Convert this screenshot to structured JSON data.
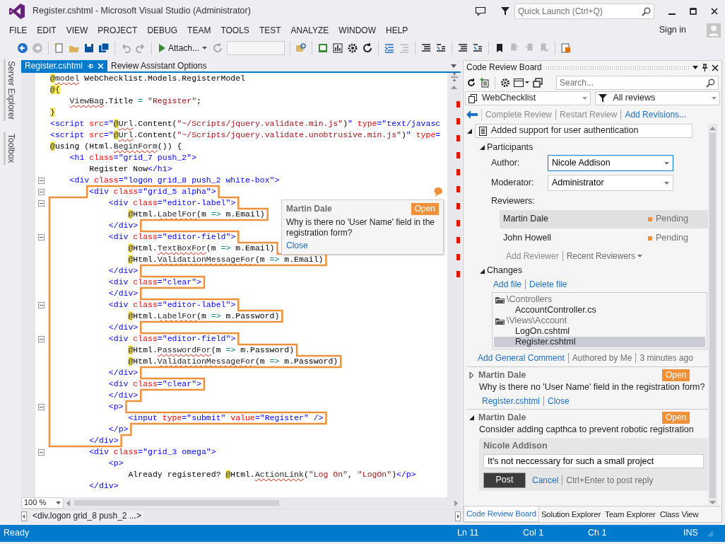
{
  "title_bar": {
    "title": "Register.cshtml - Microsoft Visual Studio (Administrator)",
    "quick_launch": {
      "placeholder": "Quick Launch (Ctrl+Q)"
    }
  },
  "menu": [
    "FILE",
    "EDIT",
    "VIEW",
    "PROJECT",
    "DEBUG",
    "TEAM",
    "TOOLS",
    "TEST",
    "ANALYZE",
    "WINDOW",
    "HELP"
  ],
  "sign_in": "Sign in",
  "toolbar": {
    "attach_button": "Attach..."
  },
  "side_tabs": [
    "Server Explorer",
    "Toolbox"
  ],
  "editor": {
    "tabs": [
      {
        "label": "Register.cshtml",
        "selected": true
      },
      {
        "label": "Review Assistant Options",
        "selected": false
      }
    ],
    "lines": [
      {
        "collapsible": false,
        "commented": false,
        "tokens": [
          {
            "kind": "at",
            "text": "@"
          },
          {
            "kind": "err",
            "text": "model"
          },
          {
            "kind": "plain",
            "text": " WebChecklist.Models.RegisterModel"
          }
        ]
      },
      {
        "collapsible": false,
        "commented": false,
        "tokens": [
          {
            "kind": "at",
            "text": "@{"
          }
        ]
      },
      {
        "collapsible": false,
        "commented": false,
        "tokens": [
          {
            "kind": "err",
            "text": "    ViewBag"
          },
          {
            "kind": "plain",
            "text": ".Title "
          },
          {
            "kind": "op",
            "text": "="
          },
          {
            "kind": "str",
            "text": " \"Register\""
          },
          {
            "kind": "plain",
            "text": ";"
          }
        ]
      },
      {
        "collapsible": false,
        "commented": false,
        "tokens": [
          {
            "kind": "at",
            "text": "}"
          }
        ]
      },
      {
        "collapsible": false,
        "commented": false,
        "tokens": [
          {
            "kind": "tag",
            "text": "<script "
          },
          {
            "kind": "attr",
            "text": "src"
          },
          {
            "kind": "tag",
            "text": "=\""
          },
          {
            "kind": "at",
            "text": "@"
          },
          {
            "kind": "err",
            "text": "Url"
          },
          {
            "kind": "plain",
            "text": ".Content("
          },
          {
            "kind": "str",
            "text": "\"~/Scripts/jquery.validate.min.js\""
          },
          {
            "kind": "plain",
            "text": ")"
          },
          {
            "kind": "tag",
            "text": "\" "
          },
          {
            "kind": "attr",
            "text": "type"
          },
          {
            "kind": "tag",
            "text": "=\"text/javasc"
          }
        ]
      },
      {
        "collapsible": false,
        "commented": false,
        "tokens": [
          {
            "kind": "tag",
            "text": "<script "
          },
          {
            "kind": "attr",
            "text": "src"
          },
          {
            "kind": "tag",
            "text": "=\""
          },
          {
            "kind": "at",
            "text": "@"
          },
          {
            "kind": "err",
            "text": "Url"
          },
          {
            "kind": "plain",
            "text": ".Content("
          },
          {
            "kind": "str",
            "text": "\"~/Scripts/jquery.validate.unobtrusive.min.js\""
          },
          {
            "kind": "plain",
            "text": ")"
          },
          {
            "kind": "tag",
            "text": "\" "
          },
          {
            "kind": "attr",
            "text": "type"
          },
          {
            "kind": "tag",
            "text": "="
          }
        ]
      },
      {
        "collapsible": false,
        "commented": false,
        "tokens": [
          {
            "kind": "at",
            "text": "@"
          },
          {
            "kind": "plain",
            "text": "using (Html."
          },
          {
            "kind": "err",
            "text": "BeginForm"
          },
          {
            "kind": "plain",
            "text": "()) {"
          }
        ]
      },
      {
        "collapsible": false,
        "commented": false,
        "tokens": [
          {
            "kind": "tag",
            "text": "    <h1 "
          },
          {
            "kind": "attr",
            "text": "class"
          },
          {
            "kind": "tag",
            "text": "=\"grid_7 push_2\">"
          }
        ]
      },
      {
        "collapsible": false,
        "commented": false,
        "tokens": [
          {
            "kind": "plain",
            "text": "        Register Now"
          },
          {
            "kind": "tag",
            "text": "</h1>"
          }
        ]
      },
      {
        "collapsible": true,
        "commented": false,
        "tokens": [
          {
            "kind": "tag",
            "text": "    <div "
          },
          {
            "kind": "attr",
            "text": "class"
          },
          {
            "kind": "tag",
            "text": "=\"logon grid_8 push_2 white-box\">"
          }
        ]
      },
      {
        "collapsible": true,
        "commented": true,
        "tokens": [
          {
            "kind": "tag",
            "text": "        <div "
          },
          {
            "kind": "attr",
            "text": "class"
          },
          {
            "kind": "tag",
            "text": "=\"grid_5 alpha\">"
          }
        ]
      },
      {
        "collapsible": true,
        "commented": true,
        "tokens": [
          {
            "kind": "tag",
            "text": "            <div "
          },
          {
            "kind": "attr",
            "text": "class"
          },
          {
            "kind": "tag",
            "text": "=\"editor-label\">"
          }
        ]
      },
      {
        "collapsible": false,
        "commented": true,
        "tokens": [
          {
            "kind": "at",
            "text": "                @"
          },
          {
            "kind": "plain",
            "text": "Html."
          },
          {
            "kind": "err",
            "text": "LabelFor"
          },
          {
            "kind": "plain",
            "text": "(m "
          },
          {
            "kind": "op",
            "text": "=>"
          },
          {
            "kind": "plain",
            "text": " m.Email)"
          }
        ]
      },
      {
        "collapsible": false,
        "commented": true,
        "tokens": [
          {
            "kind": "tag",
            "text": "            </div>"
          }
        ]
      },
      {
        "collapsible": true,
        "commented": true,
        "tokens": [
          {
            "kind": "tag",
            "text": "            <div "
          },
          {
            "kind": "attr",
            "text": "class"
          },
          {
            "kind": "tag",
            "text": "=\"editor-field\">"
          }
        ]
      },
      {
        "collapsible": false,
        "commented": true,
        "tokens": [
          {
            "kind": "at",
            "text": "                @"
          },
          {
            "kind": "plain",
            "text": "Html."
          },
          {
            "kind": "err",
            "text": "TextBoxFor"
          },
          {
            "kind": "plain",
            "text": "(m "
          },
          {
            "kind": "op",
            "text": "=>"
          },
          {
            "kind": "plain",
            "text": " m.Email)"
          }
        ]
      },
      {
        "collapsible": false,
        "commented": true,
        "tokens": [
          {
            "kind": "at",
            "text": "                @"
          },
          {
            "kind": "plain",
            "text": "Html."
          },
          {
            "kind": "err",
            "text": "ValidationMessageFor"
          },
          {
            "kind": "plain",
            "text": "(m "
          },
          {
            "kind": "op",
            "text": "=>"
          },
          {
            "kind": "plain",
            "text": " m.Email)"
          }
        ]
      },
      {
        "collapsible": false,
        "commented": true,
        "tokens": [
          {
            "kind": "tag",
            "text": "            </div>"
          }
        ]
      },
      {
        "collapsible": false,
        "commented": true,
        "tokens": [
          {
            "kind": "tag",
            "text": "            <div "
          },
          {
            "kind": "attr",
            "text": "class"
          },
          {
            "kind": "tag",
            "text": "=\"clear\">"
          }
        ]
      },
      {
        "collapsible": false,
        "commented": true,
        "tokens": [
          {
            "kind": "tag",
            "text": "            </div>"
          }
        ]
      },
      {
        "collapsible": true,
        "commented": true,
        "tokens": [
          {
            "kind": "tag",
            "text": "            <div "
          },
          {
            "kind": "attr",
            "text": "class"
          },
          {
            "kind": "tag",
            "text": "=\"editor-label\">"
          }
        ]
      },
      {
        "collapsible": false,
        "commented": true,
        "tokens": [
          {
            "kind": "at",
            "text": "                @"
          },
          {
            "kind": "plain",
            "text": "Html."
          },
          {
            "kind": "err",
            "text": "LabelFor"
          },
          {
            "kind": "plain",
            "text": "(m "
          },
          {
            "kind": "op",
            "text": "=>"
          },
          {
            "kind": "plain",
            "text": " m.Password)"
          }
        ]
      },
      {
        "collapsible": false,
        "commented": true,
        "tokens": [
          {
            "kind": "tag",
            "text": "            </div>"
          }
        ]
      },
      {
        "collapsible": true,
        "commented": true,
        "tokens": [
          {
            "kind": "tag",
            "text": "            <div "
          },
          {
            "kind": "attr",
            "text": "class"
          },
          {
            "kind": "tag",
            "text": "=\"editor-field\">"
          }
        ]
      },
      {
        "collapsible": false,
        "commented": true,
        "tokens": [
          {
            "kind": "at",
            "text": "                @"
          },
          {
            "kind": "plain",
            "text": "Html."
          },
          {
            "kind": "err",
            "text": "PasswordFor"
          },
          {
            "kind": "plain",
            "text": "(m "
          },
          {
            "kind": "op",
            "text": "=>"
          },
          {
            "kind": "plain",
            "text": " m.Password)"
          }
        ]
      },
      {
        "collapsible": false,
        "commented": true,
        "tokens": [
          {
            "kind": "at",
            "text": "                @"
          },
          {
            "kind": "plain",
            "text": "Html."
          },
          {
            "kind": "err",
            "text": "ValidationMessageFor"
          },
          {
            "kind": "plain",
            "text": "(m "
          },
          {
            "kind": "op",
            "text": "=>"
          },
          {
            "kind": "plain",
            "text": " m.Password)"
          }
        ]
      },
      {
        "collapsible": false,
        "commented": true,
        "tokens": [
          {
            "kind": "tag",
            "text": "            </div>"
          }
        ]
      },
      {
        "collapsible": false,
        "commented": true,
        "tokens": [
          {
            "kind": "tag",
            "text": "            <div "
          },
          {
            "kind": "attr",
            "text": "class"
          },
          {
            "kind": "tag",
            "text": "=\"clear\">"
          }
        ]
      },
      {
        "collapsible": false,
        "commented": true,
        "tokens": [
          {
            "kind": "tag",
            "text": "            </div>"
          }
        ]
      },
      {
        "collapsible": true,
        "commented": true,
        "tokens": [
          {
            "kind": "tag",
            "text": "            <p>"
          }
        ]
      },
      {
        "collapsible": false,
        "commented": true,
        "tokens": [
          {
            "kind": "tag",
            "text": "                <input "
          },
          {
            "kind": "attr",
            "text": "type"
          },
          {
            "kind": "tag",
            "text": "=\"submit\" "
          },
          {
            "kind": "attr",
            "text": "value"
          },
          {
            "kind": "tag",
            "text": "=\"Register\" />"
          }
        ]
      },
      {
        "collapsible": false,
        "commented": true,
        "tokens": [
          {
            "kind": "tag",
            "text": "            </p>"
          }
        ]
      },
      {
        "collapsible": false,
        "commented": true,
        "tokens": [
          {
            "kind": "tag",
            "text": "        </div>"
          }
        ]
      },
      {
        "collapsible": true,
        "commented": false,
        "tokens": [
          {
            "kind": "tag",
            "text": "        <div "
          },
          {
            "kind": "attr",
            "text": "class"
          },
          {
            "kind": "tag",
            "text": "=\"grid_3 omega\">"
          }
        ]
      },
      {
        "collapsible": false,
        "commented": false,
        "tokens": [
          {
            "kind": "tag",
            "text": "            <p>"
          }
        ]
      },
      {
        "collapsible": false,
        "commented": false,
        "tokens": [
          {
            "kind": "plain",
            "text": "                Already registered? "
          },
          {
            "kind": "at",
            "text": "@"
          },
          {
            "kind": "plain",
            "text": "Html."
          },
          {
            "kind": "err",
            "text": "ActionLink"
          },
          {
            "kind": "plain",
            "text": "("
          },
          {
            "kind": "str",
            "text": "\"Log On\""
          },
          {
            "kind": "plain",
            "text": ", "
          },
          {
            "kind": "str",
            "text": "\"LogOn\""
          },
          {
            "kind": "plain",
            "text": ")"
          },
          {
            "kind": "tag",
            "text": "</p>"
          }
        ]
      },
      {
        "collapsible": false,
        "commented": false,
        "tokens": [
          {
            "kind": "tag",
            "text": "        </div>"
          }
        ]
      }
    ],
    "comment_popup": {
      "author": "Martin Dale",
      "status": "Open",
      "text": "Why is there no 'User Name' field  in the registration form?",
      "close": "Close"
    },
    "zoom": "100 %",
    "breadcrumb": "<div.logon grid_8 push_2 ...>"
  },
  "review_board": {
    "title": "Code Review Board",
    "search": {
      "placeholder": "Search..."
    },
    "project": "WebChecklist",
    "filter": "All reviews",
    "actions": [
      {
        "label": "Complete Review",
        "disabled": true
      },
      {
        "label": "Restart Review",
        "disabled": true
      },
      {
        "label": "Add Revisions...",
        "disabled": false
      }
    ],
    "review": {
      "title": "Added support for user authentication",
      "expanded": true,
      "participants": {
        "label": "Participants",
        "expanded": true,
        "author": {
          "label": "Author:",
          "value": "Nicole Addison",
          "focused": true
        },
        "moderator": {
          "label": "Moderator:",
          "value": "Administrator",
          "focused": false
        },
        "reviewers_label": "Reviewers:",
        "reviewers": [
          {
            "name": "Martin Dale",
            "status": "Pending",
            "color": "#f0913a",
            "selected": true
          },
          {
            "name": "John Howell",
            "status": "Pending",
            "color": "#f0913a",
            "selected": false
          }
        ],
        "reviewer_actions": [
          {
            "label": "Add Reviewer",
            "disabled": true,
            "dropdown": false
          },
          {
            "label": "Recent Reviewers",
            "disabled": false,
            "dropdown": true
          }
        ]
      },
      "changes": {
        "label": "Changes",
        "expanded": true,
        "actions": [
          "Add file",
          "Delete file"
        ],
        "files": [
          {
            "name": "\\Controllers",
            "selected": false,
            "children": [
              {
                "name": "AccountController.cs",
                "selected": false
              }
            ]
          },
          {
            "name": "\\Views\\Account",
            "selected": false,
            "children": [
              {
                "name": "LogOn.cshtml",
                "selected": false
              },
              {
                "name": "Register.cshtml",
                "selected": true
              }
            ]
          }
        ]
      },
      "meta": [
        {
          "kind": "link",
          "text": "Add General Comment"
        },
        {
          "kind": "text",
          "text": "Authored by Me"
        },
        {
          "kind": "text",
          "text": "3 minutes ago"
        }
      ]
    },
    "comments": [
      {
        "author": "Martin Dale",
        "status": "Open",
        "expanded": false,
        "text": "Why is there no 'User Name' field  in the registration form?",
        "links": [
          "Register.cshtml",
          "Close"
        ]
      },
      {
        "author": "Martin Dale",
        "status": "Open",
        "expanded": true,
        "text": "Consider  adding capthca to prevent robotic registration",
        "reply": {
          "author": "Nicole Addison",
          "value": "It's not neccessary for such a small project",
          "post": "Post",
          "cancel": "Cancel",
          "hint": "Ctrl+Enter to post reply"
        }
      }
    ],
    "tabs": [
      {
        "label": "Code Review Board",
        "selected": true
      },
      {
        "label": "Solution Explorer",
        "selected": false
      },
      {
        "label": "Team Explorer",
        "selected": false
      },
      {
        "label": "Class View",
        "selected": false
      }
    ]
  },
  "status_bar": {
    "message": "Ready",
    "line": "Ln 11",
    "column": "Col 1",
    "char": "Ch 1",
    "mode": "INS"
  }
}
